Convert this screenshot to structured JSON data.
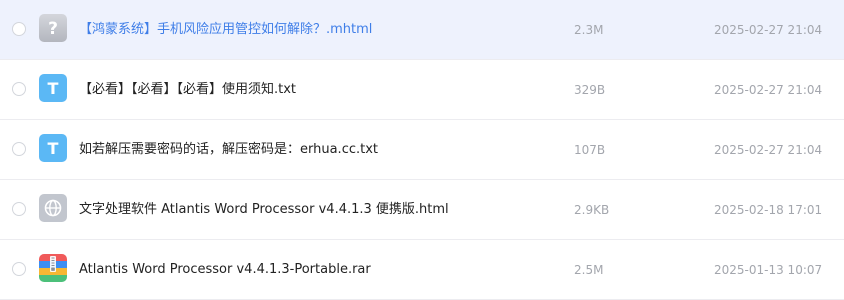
{
  "files": [
    {
      "name": "【鸿蒙系统】手机风险应用管控如何解除？.mhtml",
      "size": "2.3M",
      "date": "2025-02-27 21:04",
      "icon": "unknown-file-icon",
      "selected": true
    },
    {
      "name": "【必看】【必看】【必看】使用须知.txt",
      "size": "329B",
      "date": "2025-02-27 21:04",
      "icon": "text-file-icon",
      "selected": false
    },
    {
      "name": "如若解压需要密码的话，解压密码是：erhua.cc.txt",
      "size": "107B",
      "date": "2025-02-27 21:04",
      "icon": "text-file-icon",
      "selected": false
    },
    {
      "name": "文字处理软件 Atlantis Word Processor v4.4.1.3 便携版.html",
      "size": "2.9KB",
      "date": "2025-02-18 17:01",
      "icon": "web-file-icon",
      "selected": false
    },
    {
      "name": "Atlantis Word Processor v4.4.1.3-Portable.rar",
      "size": "2.5M",
      "date": "2025-01-13 10:07",
      "icon": "archive-file-icon",
      "selected": false
    }
  ],
  "colors": {
    "selected_row_bg": "#eef2fd",
    "selected_name": "#3f7ee8",
    "text_icon": "#5bb8f5",
    "meta_text": "#a3a6ad"
  },
  "glyphs": {
    "unknown": "?",
    "text": "T"
  }
}
